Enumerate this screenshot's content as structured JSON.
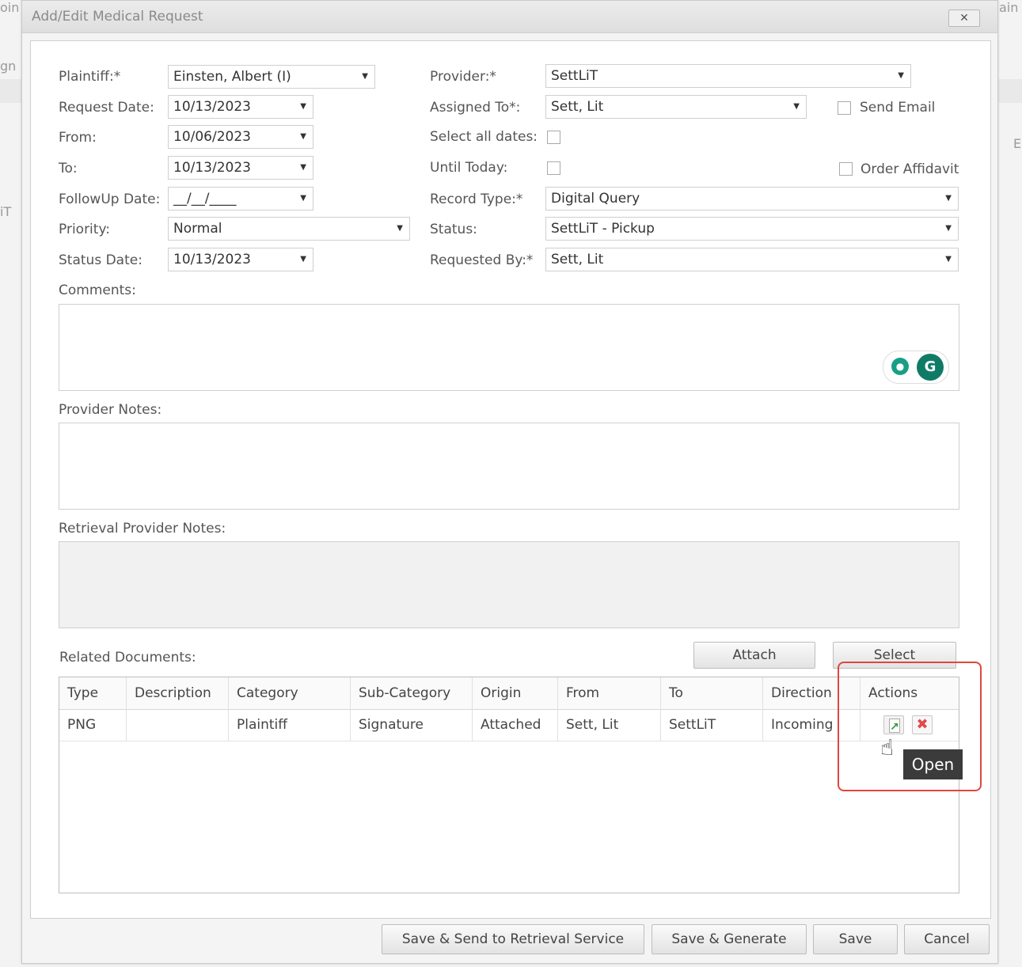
{
  "dialog": {
    "title": "Add/Edit Medical Request",
    "close": "✕"
  },
  "form": {
    "plaintiff": {
      "label": "Plaintiff:*",
      "value": "Einsten, Albert (I)"
    },
    "request_date": {
      "label": "Request Date:",
      "value": "10/13/2023"
    },
    "from": {
      "label": "From:",
      "value": "10/06/2023"
    },
    "to": {
      "label": "To:",
      "value": "10/13/2023"
    },
    "followup_date": {
      "label": "FollowUp Date:",
      "value": "__/__/____"
    },
    "priority": {
      "label": "Priority:",
      "value": "Normal"
    },
    "status_date": {
      "label": "Status Date:",
      "value": "10/13/2023"
    },
    "provider": {
      "label": "Provider:*",
      "value": "SettLiT"
    },
    "assigned_to": {
      "label": "Assigned To*:",
      "value": "Sett, Lit"
    },
    "send_email": {
      "label": "Send Email",
      "checked": false
    },
    "select_all_dates": {
      "label": "Select all dates:",
      "checked": false
    },
    "until_today": {
      "label": "Until Today:",
      "checked": false
    },
    "order_affidavit": {
      "label": "Order Affidavit",
      "checked": false
    },
    "record_type": {
      "label": "Record Type:*",
      "value": "Digital Query"
    },
    "status": {
      "label": "Status:",
      "value": "SettLiT - Pickup"
    },
    "requested_by": {
      "label": "Requested By:*",
      "value": "Sett, Lit"
    },
    "comments_label": "Comments:",
    "provider_notes_label": "Provider Notes:",
    "retrieval_notes_label": "Retrieval Provider Notes:"
  },
  "documents": {
    "label": "Related Documents:",
    "attach": "Attach",
    "select": "Select",
    "columns": [
      "Type",
      "Description",
      "Category",
      "Sub-Category",
      "Origin",
      "From",
      "To",
      "Direction",
      "Actions"
    ],
    "rows": [
      [
        "PNG",
        "",
        "Plaintiff",
        "Signature",
        "Attached",
        "Sett, Lit",
        "SettLiT",
        "Incoming"
      ]
    ],
    "tooltip": "Open"
  },
  "footer": {
    "save_send": "Save & Send to Retrieval Service",
    "save_generate": "Save & Generate",
    "save": "Save",
    "cancel": "Cancel"
  },
  "background": {
    "t1": "oin",
    "t2": "gn",
    "t3": "iT",
    "t4": "ain",
    "t5": "E"
  },
  "colors": {
    "highlight": "#e0473d",
    "tooltip_bg": "#3b3b3b"
  }
}
